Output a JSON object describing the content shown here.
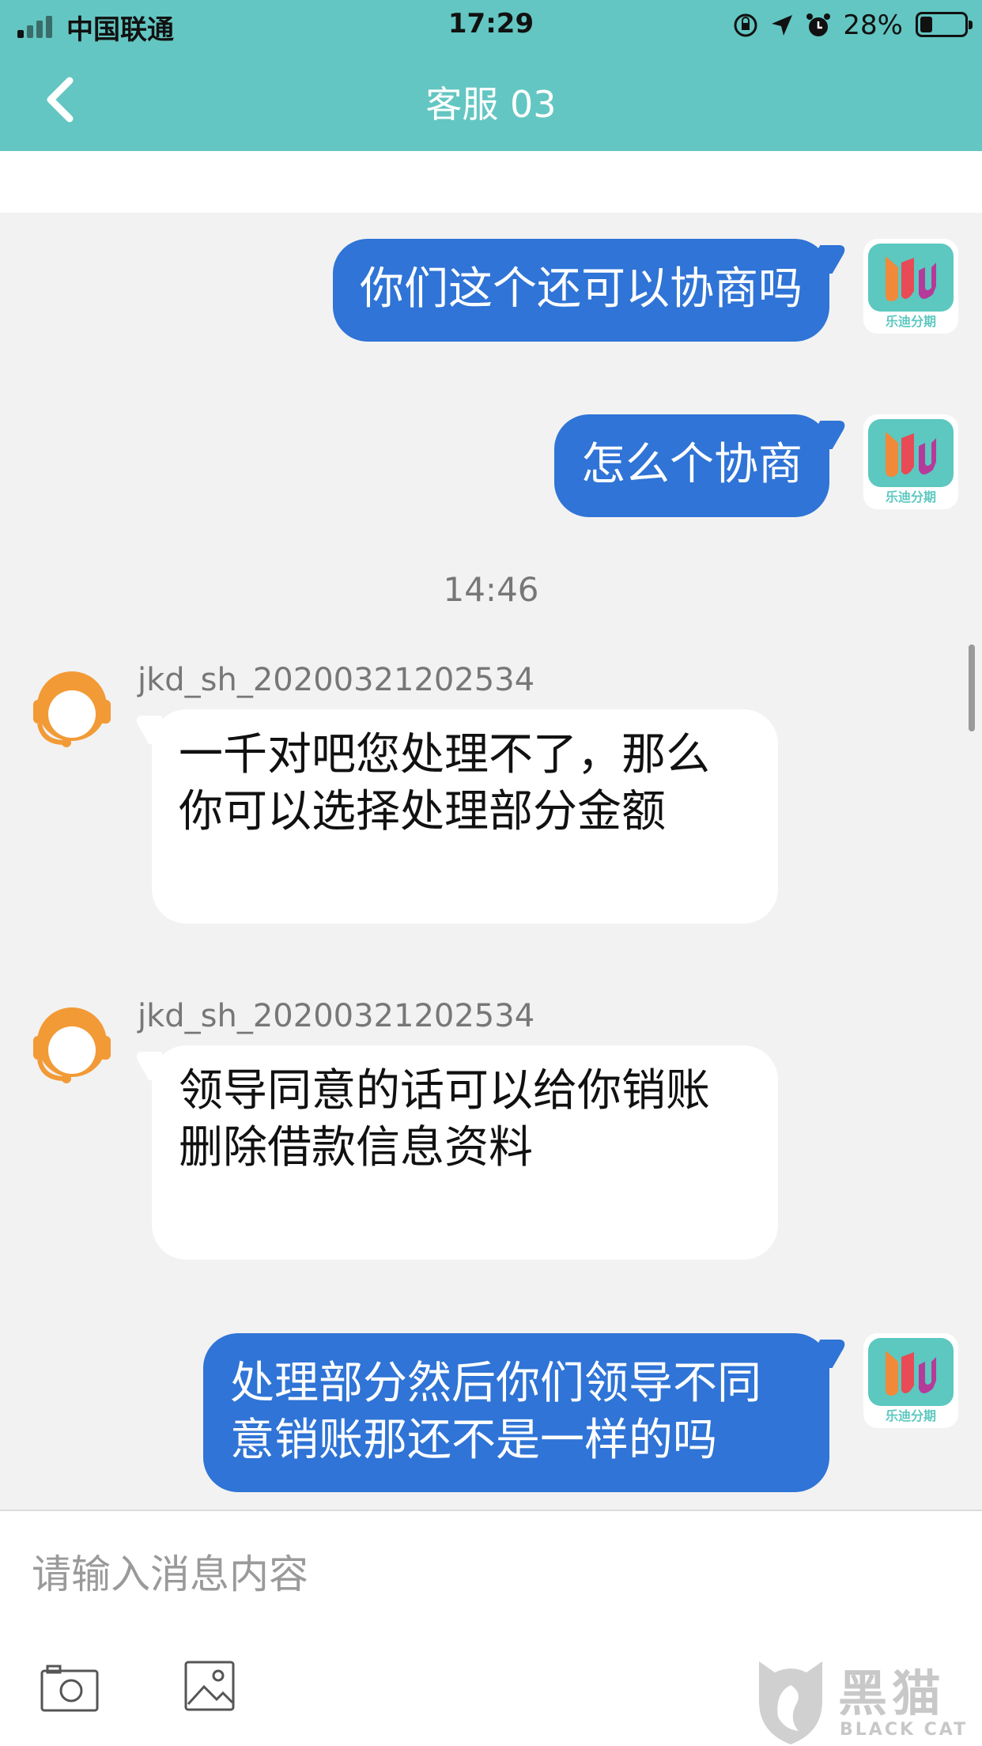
{
  "status_bar": {
    "carrier": "中国联通",
    "time": "17:29",
    "battery": "28%",
    "battery_level": 0.28
  },
  "header": {
    "title": "客服 03",
    "back_icon": "chevron-left-icon"
  },
  "messages": [
    {
      "side": "me",
      "text": "你们这个还可以协商吗"
    },
    {
      "side": "me",
      "text": "怎么个协商"
    },
    {
      "type": "timestamp",
      "text": "14:46"
    },
    {
      "side": "them",
      "sender": "jkd_sh_20200321202534",
      "lines": [
        "一千对吧您处理不了，那么",
        "你可以选择处理部分金额"
      ]
    },
    {
      "side": "them",
      "sender": "jkd_sh_20200321202534",
      "lines": [
        "领导同意的话可以给你销账",
        "删除借款信息资料"
      ]
    },
    {
      "side": "me",
      "lines": [
        "处理部分然后你们领导不同",
        "意销账那还不是一样的吗"
      ]
    }
  ],
  "app_avatar": {
    "caption": "乐迪分期"
  },
  "input": {
    "placeholder": "请输入消息内容",
    "camera_icon": "camera-icon",
    "image_icon": "image-icon"
  },
  "watermark": {
    "logo_text": "黑猫",
    "sub_text": "BLACK CAT"
  },
  "colors": {
    "header": "#63c6c2",
    "my_bubble": "#2f74d6",
    "their_bubble": "#ffffff",
    "agent_avatar": "#f29a36"
  }
}
